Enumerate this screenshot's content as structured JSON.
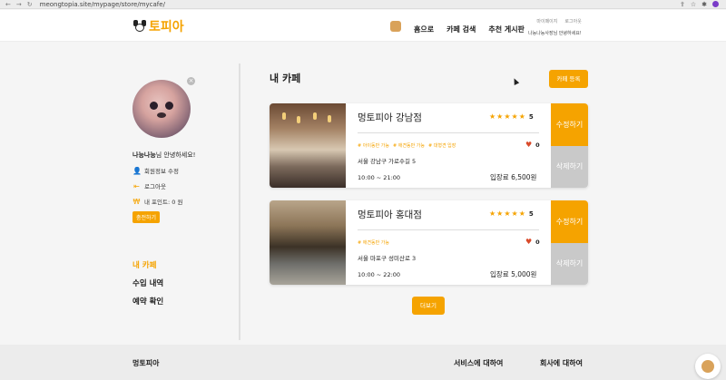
{
  "browser": {
    "url": "meongtopia.site/mypage/store/mycafe/"
  },
  "header": {
    "logo_text": "토피아",
    "nav": [
      "홈으로",
      "카페 검색",
      "추천 게시판"
    ],
    "mypage_label": "마이페이지",
    "logout_label": "로그아웃",
    "welcome": "나능나능사장님 안녕하세요!"
  },
  "sidebar": {
    "greeting_name": "나능나능",
    "greeting_suffix": "님 안녕하세요!",
    "edit_profile": "회원정보 수정",
    "logout": "로그아웃",
    "points": "내 포인트: 0 원",
    "charge": "충전하기",
    "menu": [
      "내 카페",
      "수입 내역",
      "예약 확인"
    ]
  },
  "main": {
    "title": "내 카페",
    "register_label": "카페 등록",
    "more_label": "더보기",
    "edit_label": "수정하기",
    "delete_label": "삭제하기",
    "cafes": [
      {
        "name": "멍토피아 강남점",
        "rating": "5",
        "tags": [
          "# 아이동반 가능",
          "# 애견동반 가능",
          "# 대형견 입장"
        ],
        "likes": "0",
        "address": "서울 강남구 가로수길 5",
        "hours": "10:00 ~ 21:00",
        "fee": "입장료 6,500원"
      },
      {
        "name": "멍토피아 홍대점",
        "rating": "5",
        "tags": [
          "# 애견동반 가능"
        ],
        "likes": "0",
        "address": "서울 마포구 성미산로 3",
        "hours": "10:00 ~ 22:00",
        "fee": "입장료 5,000원"
      }
    ]
  },
  "footer": {
    "brand": "멍토피아",
    "service": "서비스에 대하여",
    "company": "회사에 대하여"
  },
  "colors": {
    "accent": "#f5a300",
    "delete": "#c9c9c9",
    "heart": "#d94a2a"
  }
}
